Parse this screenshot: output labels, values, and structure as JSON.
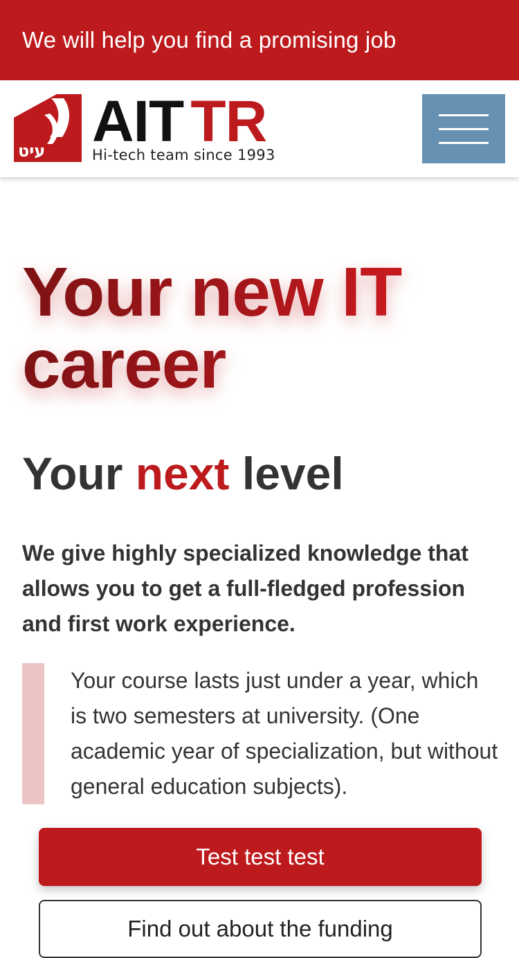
{
  "top_banner": {
    "text": "We will help you find a promising job"
  },
  "header": {
    "logo": {
      "mark_text": "עיט",
      "name_part1": "AIT",
      "name_part2": "TR",
      "tagline": "Hi-tech team since 1993"
    },
    "menu_button_icon": "hamburger-menu-icon"
  },
  "hero": {
    "title": "Your new IT career",
    "subtitle_start": "Your",
    "subtitle_accent": "next",
    "subtitle_end": "level",
    "lead": "We give highly specialized knowledge that allows you to get a full-fledged profession and first work experience.",
    "quote": "Your course lasts just under a year, which is two semesters at university. (One academic year of specialization, but without general education subjects)."
  },
  "buttons": {
    "primary_label": "Test test test",
    "secondary_label": "Find out about the funding"
  },
  "colors": {
    "brand_red": "#bd1a1d",
    "menu_blue": "#6691b2",
    "quote_bar": "#ecc4c6",
    "text_dark": "#333333"
  }
}
